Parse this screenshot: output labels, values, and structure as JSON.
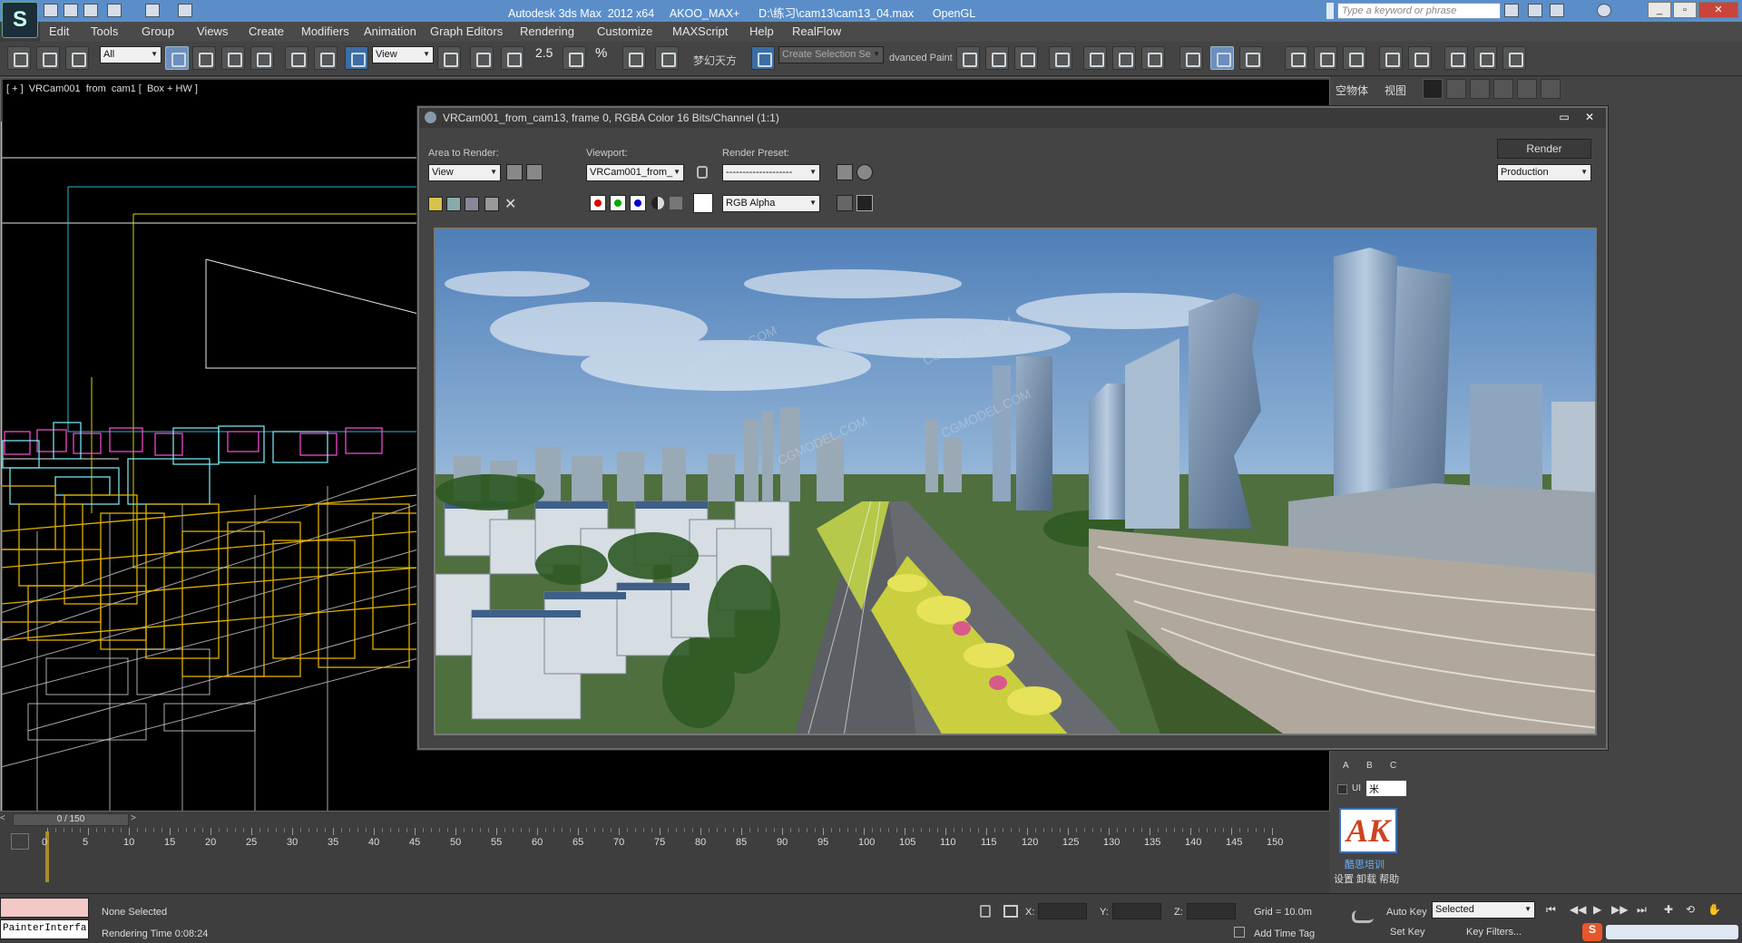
{
  "app": {
    "title": "Autodesk 3ds Max  2012 x64     AKOO_MAX+      D:\\练习\\cam13\\cam13_04.max      OpenGL",
    "search_placeholder": "Type a keyword or phrase",
    "logo_glyph": "S"
  },
  "menu": {
    "items": [
      "Edit",
      "Tools",
      "Group",
      "Views",
      "Create",
      "Modifiers",
      "Animation",
      "Graph Editors",
      "Rendering",
      "Customize",
      "MAXScript",
      "Help",
      "RealFlow"
    ]
  },
  "toolbar": {
    "selection_filter": "All",
    "ref_coord": "View",
    "snap_label": "2.5",
    "pct_label": "%",
    "chinese_label": "梦幻天方",
    "selection_set_placeholder": "Create Selection Se",
    "advanced_paint": "dvanced Paint"
  },
  "viewport": {
    "label": "[ + ]  VRCam001  from  cam1 [  Box + HW ]"
  },
  "right_panel": {
    "tabs": [
      "空物体",
      "视图"
    ],
    "abc": [
      "A",
      "B",
      "C"
    ],
    "ui_label": "UI",
    "dd_value": "米",
    "ak_logo": "AK",
    "ak_caption": "酷思培训",
    "ak_links": "设置 卸载 帮助"
  },
  "render_window": {
    "title": "VRCam001_from_cam13, frame 0, RGBA Color 16 Bits/Channel (1:1)",
    "area_label": "Area to Render:",
    "area_value": "View",
    "viewport_label": "Viewport:",
    "viewport_value": "VRCam001_from_",
    "preset_label": "Render Preset:",
    "preset_value": "--------------------",
    "render_button": "Render",
    "mode_value": "Production",
    "channel_value": "RGB Alpha",
    "watermarks": [
      "CGMODEL.COM",
      "CGMODEL.COM",
      "CGMODEL.COM",
      "CGMODEL.COM"
    ]
  },
  "timeline": {
    "frame_indicator": "0 / 150",
    "ticks": [
      "0",
      "5",
      "10",
      "15",
      "20",
      "25",
      "30",
      "35",
      "40",
      "45",
      "50",
      "55",
      "60",
      "65",
      "70",
      "75",
      "80",
      "85",
      "90",
      "95",
      "100",
      "105",
      "110",
      "115",
      "120",
      "125",
      "130",
      "135",
      "140",
      "145",
      "150"
    ]
  },
  "status": {
    "script_label": "PainterInterfa",
    "selection_text": "None Selected",
    "rendering_time": "Rendering Time  0:08:24",
    "x_label": "X:",
    "y_label": "Y:",
    "z_label": "Z:",
    "grid": "Grid = 10.0m",
    "add_time_tag": "Add Time Tag",
    "auto_key": "Auto Key",
    "set_key": "Set Key",
    "key_mode": "Selected",
    "key_filters": "Key Filters..."
  }
}
